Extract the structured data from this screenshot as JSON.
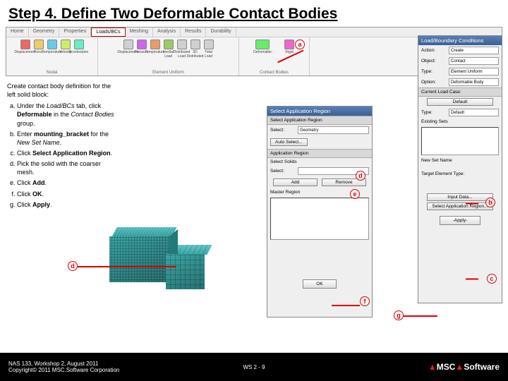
{
  "title": "Step 4. Define Two Deformable Contact Bodies",
  "ribbon": {
    "tabs": [
      "Home",
      "Geometry",
      "Properties",
      "Loads/BCs",
      "Meshing",
      "Analysis",
      "Results",
      "Durability"
    ],
    "active_tab": "Loads/BCs",
    "groups": {
      "nodal": {
        "label": "Nodal",
        "icons": [
          "Displacement",
          "Force",
          "Temperature",
          "Velocity",
          "Acceleration"
        ]
      },
      "element": {
        "label": "Element Uniform",
        "icons": [
          "Displacement",
          "Pressure",
          "Temperature",
          "Inertial Load",
          "Distributed Load",
          "3D Distributed",
          "Total Load"
        ]
      },
      "contact": {
        "label": "Contact Bodies",
        "icons": [
          "Deformable",
          "Rigid"
        ]
      }
    }
  },
  "instr": {
    "intro": "Create contact body definition for the left solid block:",
    "a_pre": "Under the ",
    "a_em1": "Load/BCs",
    "a_mid": " tab, click ",
    "a_b": "Deformable",
    "a_post": " in the ",
    "a_em2": "Contact Bodies",
    "a_end": " group.",
    "b_pre": "Enter ",
    "b_b": "mounting_bracket",
    "b_post": " for the ",
    "b_em": "New Set Name",
    "b_end": ".",
    "c_pre": "Click ",
    "c_b": "Select Application Region",
    "c_end": ".",
    "d": "Pick the solid with the coarser mesh.",
    "e_pre": "Click ",
    "e_b": "Add",
    "e_end": ".",
    "f_pre": "Click ",
    "f_b": "OK",
    "f_end": ".",
    "g_pre": "Click ",
    "g_b": "Apply",
    "g_end": "."
  },
  "lbc": {
    "title": "Load/Boundary Conditions",
    "action_l": "Action:",
    "action_v": "Create",
    "object_l": "Object:",
    "object_v": "Contact",
    "type_l": "Type:",
    "type_v": "Element Uniform",
    "option_l": "Option:",
    "option_v": "Deformable Body",
    "curr_case": "Current Load Case:",
    "default_btn": "Default",
    "existing": "Existing Sets",
    "type2_l": "Type:",
    "type2_v": "Default",
    "newset_l": "New Set Name",
    "newset_v": "",
    "target_l": "Target Element Type:",
    "inputdata_btn": "Input Data...",
    "selapp_btn": "Select Application Region...",
    "apply_btn": "-Apply-"
  },
  "sar": {
    "title": "Select Application Region",
    "sel_appreg": "Select Application Region",
    "select_l": "Select:",
    "select_v": "Geometry",
    "autosel": "Auto Select...",
    "appreg": "Application Region",
    "sel_solids": "Select Solids",
    "select2_l": "Select:",
    "add_btn": "Add",
    "remove_btn": "Remove",
    "master": "Master Region",
    "ok_btn": "OK"
  },
  "callouts": {
    "a": "a",
    "b": "b",
    "c": "c",
    "d": "d",
    "e": "e",
    "f": "f",
    "g": "g"
  },
  "footer": {
    "line1": "NAS 133, Workshop 2, August 2011",
    "line2": "Copyright© 2011 MSC.Software Corporation",
    "slide": "WS 2 - 9",
    "logo_pre": "MSC",
    "logo_post": "Software"
  }
}
